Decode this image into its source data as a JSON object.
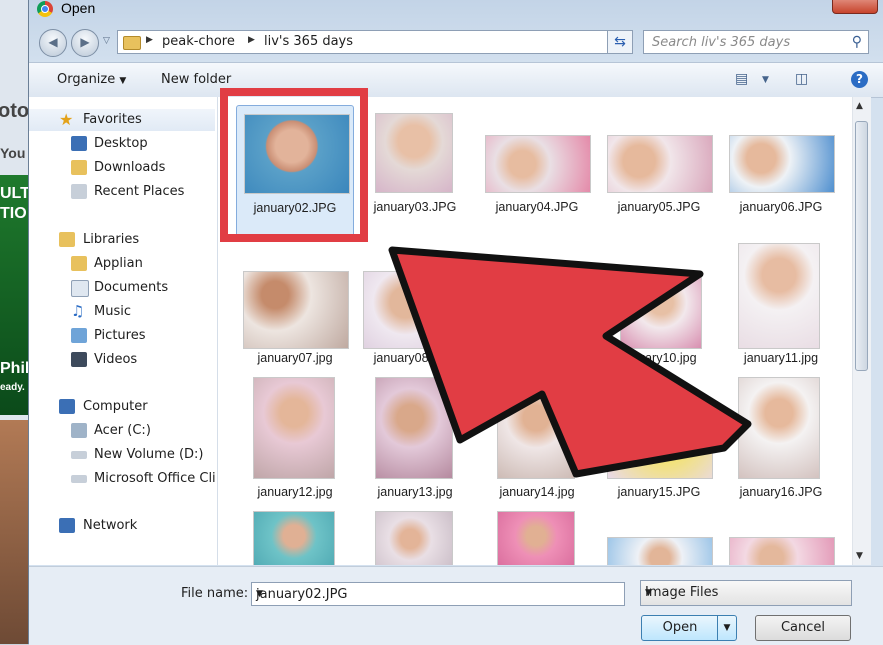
{
  "background": {
    "fragments": [
      "oto",
      "You",
      "ULT",
      "TIO",
      "Phil",
      "eady."
    ]
  },
  "window": {
    "title": "Open"
  },
  "address": {
    "crumbs": [
      "peak-chore",
      "liv's 365 days"
    ],
    "search_placeholder": "Search liv's 365 days"
  },
  "toolbar": {
    "organize": "Organize",
    "new_folder": "New folder"
  },
  "nav": {
    "favorites_header": "Favorites",
    "favorites": [
      "Desktop",
      "Downloads",
      "Recent Places"
    ],
    "libraries_header": "Libraries",
    "libraries": [
      "Applian",
      "Documents",
      "Music",
      "Pictures",
      "Videos"
    ],
    "computer_header": "Computer",
    "computer": [
      "Acer (C:)",
      "New Volume (D:)",
      "Microsoft Office Clic"
    ],
    "network_header": "Network"
  },
  "files": [
    "january02.JPG",
    "january03.JPG",
    "january04.JPG",
    "january05.JPG",
    "january06.JPG",
    "january07.jpg",
    "january08.JPG",
    "january10.jpg",
    "january11.jpg",
    "january12.jpg",
    "january13.jpg",
    "january14.jpg",
    "january15.JPG",
    "january16.JPG"
  ],
  "bottom": {
    "file_name_label": "File name:",
    "file_name_value": "january02.JPG",
    "file_type": "Image Files",
    "open": "Open",
    "cancel": "Cancel"
  },
  "colors": {
    "highlight": "#e13d44",
    "selection": "#dbeaf9"
  }
}
